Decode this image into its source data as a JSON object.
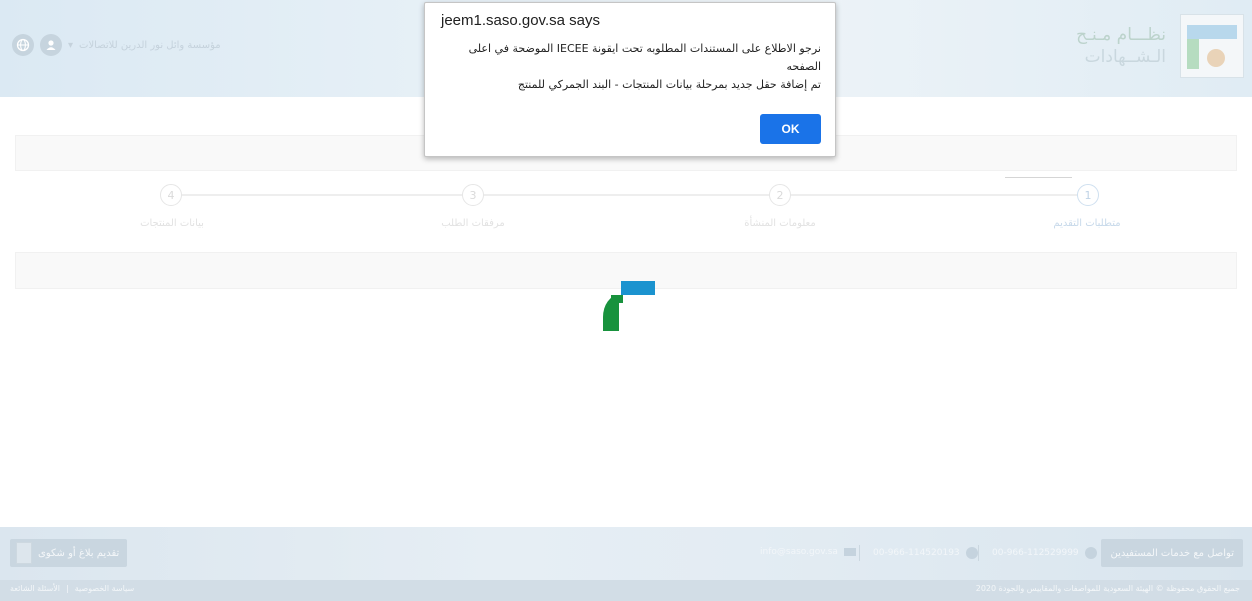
{
  "header": {
    "logo_text_line1": "نظـــام مـنـح",
    "logo_text_line2": "الـشــهادات",
    "user_name": "مؤسسة وائل نور الدرين للاتصالات",
    "user_caret": "▾"
  },
  "steps": [
    {
      "number": "1",
      "label": "متطلبات التقديم"
    },
    {
      "number": "2",
      "label": "معلومات المنشأة"
    },
    {
      "number": "3",
      "label": "مرفقات الطلب"
    },
    {
      "number": "4",
      "label": "بيانات المنتجات"
    }
  ],
  "dialog": {
    "title": "jeem1.saso.gov.sa says",
    "message_line1": "نرجو الاطلاع على المستندات المطلوبه تحت ايقونة IECEE الموضحة في اعلى",
    "message_line2": "الصفحه",
    "message_line3": "تم إضافة حقل جديد بمرحلة  بيانات المنتجات - البند الجمركي للمنتج",
    "ok_label": "OK"
  },
  "footer": {
    "contact_label": "تواصل مع خدمات المستفيدين",
    "phone1": "00-966-112529999",
    "phone2": "00-966-114520193",
    "email": "info@saso.gov.sa",
    "complaint_label": "تقديم بلاغ أو شكوى",
    "copyright": "جميع الحقوق محفوظة © الهيئة السعودية للمواصفات والمقاييس والجودة 2020",
    "privacy_label": "سياسة الخصوصية",
    "separator": "|",
    "faq_label": "الأسئلة الشائعة"
  },
  "colors": {
    "ok_button": "#1a73e8",
    "loader_blue": "#1b93cf",
    "loader_green": "#18923d"
  }
}
